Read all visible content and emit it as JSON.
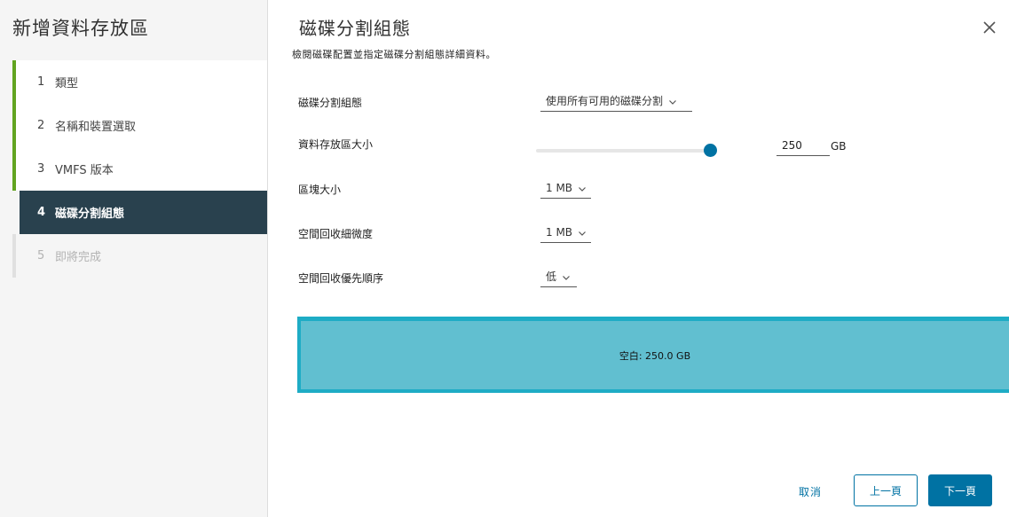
{
  "wizard": {
    "title": "新增資料存放區",
    "steps": [
      {
        "num": "1",
        "label": "類型",
        "state": "completed"
      },
      {
        "num": "2",
        "label": "名稱和裝置選取",
        "state": "completed"
      },
      {
        "num": "3",
        "label": "VMFS 版本",
        "state": "completed"
      },
      {
        "num": "4",
        "label": "磁碟分割組態",
        "state": "active"
      },
      {
        "num": "5",
        "label": "即將完成",
        "state": "disabled"
      }
    ]
  },
  "page": {
    "title": "磁碟分割組態",
    "subtitle": "檢閱磁碟配置並指定磁碟分割組態詳細資料。"
  },
  "form": {
    "partition_config": {
      "label": "磁碟分割組態",
      "value": "使用所有可用的磁碟分割"
    },
    "datastore_size": {
      "label": "資料存放區大小",
      "value": "250",
      "unit": "GB",
      "slider_fraction": 1.0
    },
    "block_size": {
      "label": "區塊大小",
      "value": "1 MB"
    },
    "reclaim_granularity": {
      "label": "空間回收細微度",
      "value": "1 MB"
    },
    "reclaim_priority": {
      "label": "空間回收優先順序",
      "value": "低"
    }
  },
  "partition_bar": {
    "label": "空白: 250.0 GB"
  },
  "footer": {
    "cancel_label": "取消",
    "back_label": "上一頁",
    "next_label": "下一頁"
  },
  "colors": {
    "accent": "#0072a3",
    "completed_step": "#62a420",
    "active_step_bg": "#29414e",
    "partition_border": "#1eacc5",
    "partition_fill": "#61bfd0"
  },
  "icons": {
    "close": "close-icon",
    "dropdown": "chevron-down-icon"
  }
}
